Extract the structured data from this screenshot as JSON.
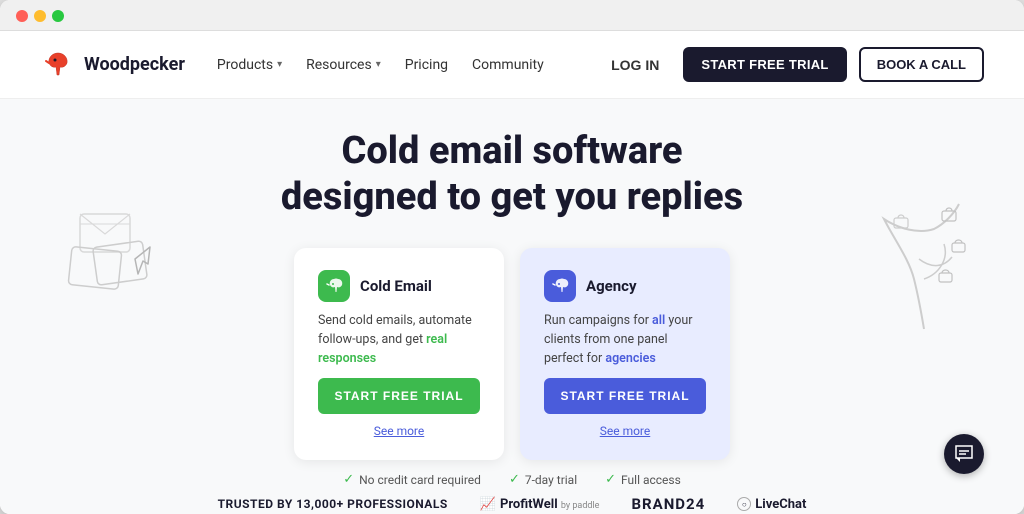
{
  "browser": {
    "dots": [
      "red",
      "yellow",
      "green"
    ]
  },
  "navbar": {
    "logo_text": "Woodpecker",
    "products_label": "Products",
    "resources_label": "Resources",
    "pricing_label": "Pricing",
    "community_label": "Community",
    "login_label": "LOG IN",
    "trial_button": "START FREE TRIAL",
    "book_call_button": "BOOK A CALL"
  },
  "hero": {
    "title_line1": "Cold email software",
    "title_line2": "designed to get you replies"
  },
  "cards": [
    {
      "id": "cold-email",
      "title": "Cold Email",
      "icon": "🐦",
      "icon_bg": "green",
      "description": "Send cold emails, automate follow-ups, and get ",
      "description_highlight": "real responses",
      "trial_button": "START FREE TRIAL",
      "see_more": "See more"
    },
    {
      "id": "agency",
      "title": "Agency",
      "icon": "🐦",
      "icon_bg": "blue",
      "description": "Run campaigns for ",
      "description_highlight_1": "all",
      "description_middle": " your clients from one panel perfect for ",
      "description_highlight_2": "agencies",
      "trial_button": "START FREE TRIAL",
      "see_more": "See more"
    }
  ],
  "bottom_info": {
    "items": [
      {
        "icon": "✓",
        "text": "No credit card required"
      },
      {
        "icon": "✓",
        "text": "7-day trial"
      },
      {
        "icon": "✓",
        "text": "Full access"
      }
    ]
  },
  "trusted": {
    "label": "TRUSTED BY 13,000+ PROFESSIONALS",
    "brands": [
      {
        "name": "ProfitWell",
        "sub": "by paddle"
      },
      {
        "name": "BRAND24",
        "sub": ""
      },
      {
        "name": "○ LiveChat",
        "sub": ""
      }
    ]
  },
  "chat": {
    "icon": "💬"
  }
}
